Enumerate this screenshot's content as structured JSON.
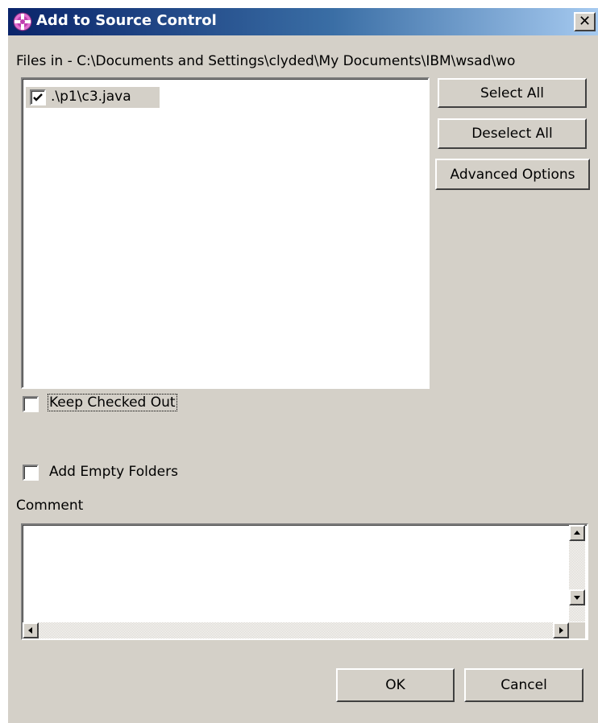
{
  "dialog": {
    "title": "Add to Source Control",
    "close_symbol": "✕"
  },
  "files_label": "Files in - C:\\Documents and Settings\\clyded\\My Documents\\IBM\\wsad\\wo",
  "file_list": [
    {
      "name": ".\\p1\\c3.java",
      "checked": true
    }
  ],
  "buttons": {
    "select_all": "Select All",
    "deselect_all": "Deselect All",
    "advanced_options": "Advanced Options",
    "ok": "OK",
    "cancel": "Cancel"
  },
  "options": {
    "keep_checked_out": {
      "label": "Keep Checked Out",
      "checked": false
    },
    "add_empty_folders": {
      "label": "Add Empty Folders",
      "checked": false
    }
  },
  "comment": {
    "label": "Comment",
    "value": ""
  },
  "icons": {
    "title": "eclipse-dialog-icon",
    "close": "close-icon",
    "check": "check-icon",
    "scroll_up": "arrow-up-icon",
    "scroll_down": "arrow-down-icon",
    "scroll_left": "arrow-left-icon",
    "scroll_right": "arrow-right-icon"
  },
  "colors": {
    "title_bar_start": "#0a246a",
    "title_bar_end": "#a6caf0",
    "dialog_face": "#d4d0c8"
  }
}
